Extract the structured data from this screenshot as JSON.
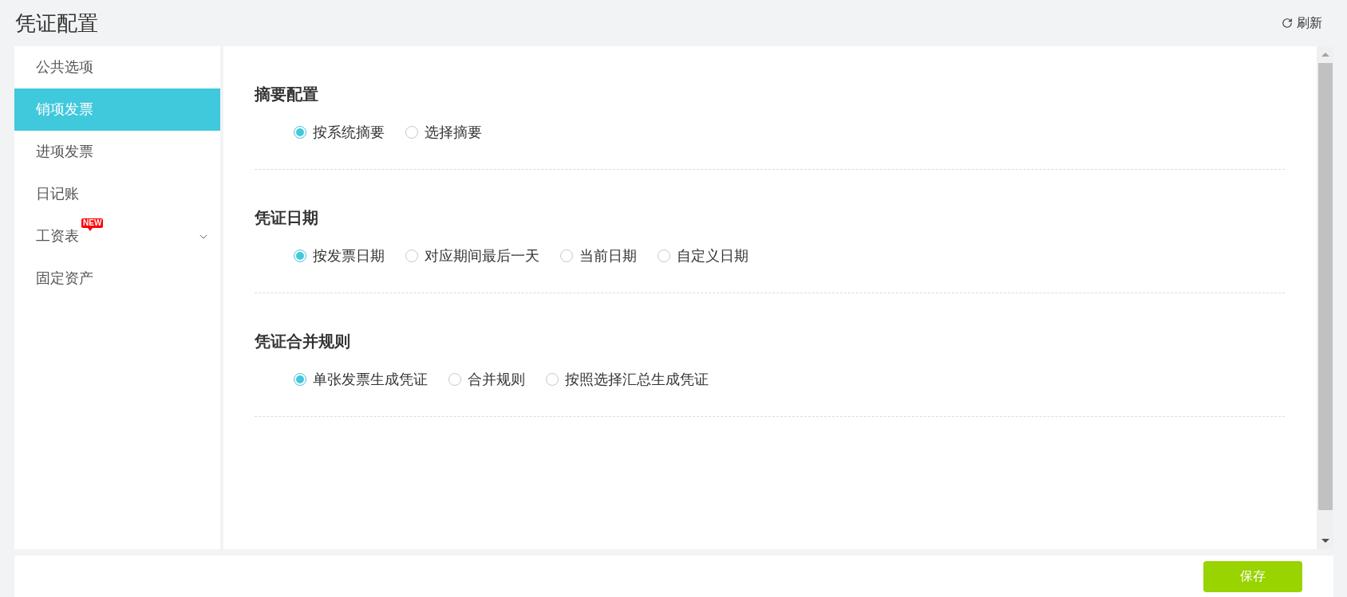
{
  "header": {
    "title": "凭证配置",
    "refresh": "刷新"
  },
  "sidebar": {
    "items": [
      {
        "label": "公共选项",
        "selected": false
      },
      {
        "label": "销项发票",
        "selected": true
      },
      {
        "label": "进项发票",
        "selected": false
      },
      {
        "label": "日记账",
        "selected": false
      },
      {
        "label": "工资表",
        "selected": false,
        "badge": "NEW",
        "expanded": false
      },
      {
        "label": "固定资产",
        "selected": false
      }
    ]
  },
  "sections": [
    {
      "title": "摘要配置",
      "options": [
        {
          "label": "按系统摘要",
          "selected": true
        },
        {
          "label": "选择摘要",
          "selected": false
        }
      ]
    },
    {
      "title": "凭证日期",
      "options": [
        {
          "label": "按发票日期",
          "selected": true
        },
        {
          "label": "对应期间最后一天",
          "selected": false
        },
        {
          "label": "当前日期",
          "selected": false
        },
        {
          "label": "自定义日期",
          "selected": false
        }
      ]
    },
    {
      "title": "凭证合并规则",
      "options": [
        {
          "label": "单张发票生成凭证",
          "selected": true
        },
        {
          "label": "合并规则",
          "selected": false
        },
        {
          "label": "按照选择汇总生成凭证",
          "selected": false
        }
      ]
    }
  ],
  "footer": {
    "save": "保存"
  }
}
